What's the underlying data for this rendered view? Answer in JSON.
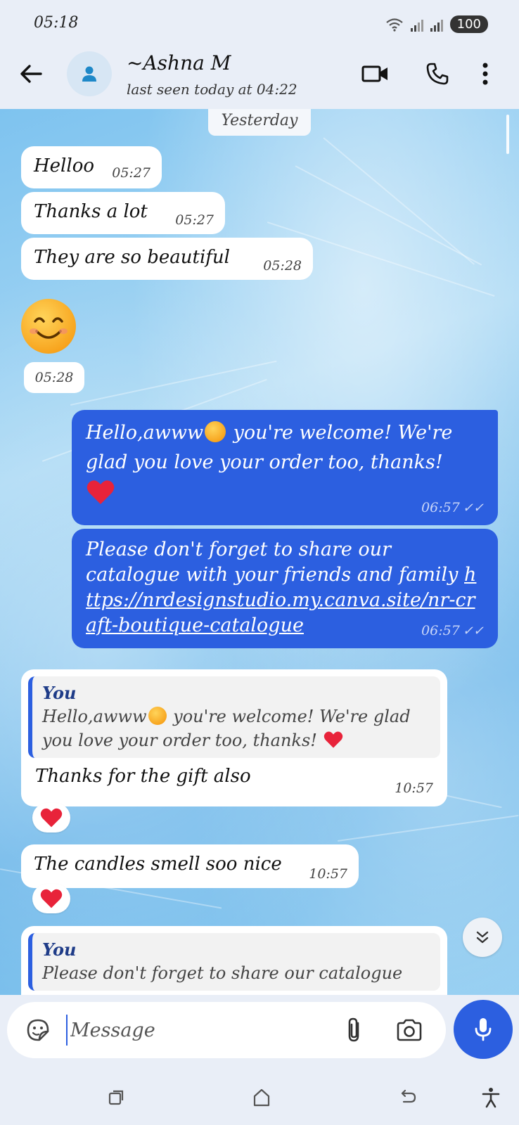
{
  "status_bar": {
    "time": "05:18",
    "battery": "100"
  },
  "header": {
    "contact_name": "~Ashna M",
    "contact_status": "last seen today at 04:22"
  },
  "chat": {
    "date_separator": "Yesterday",
    "messages": [
      {
        "direction": "in",
        "text": "Helloo",
        "time": "05:27"
      },
      {
        "direction": "in",
        "text": "Thanks a lot",
        "time": "05:27"
      },
      {
        "direction": "in",
        "text": "They are so beautiful",
        "time": "05:28"
      },
      {
        "direction": "in",
        "emoji": "smiling-face",
        "time": "05:28"
      },
      {
        "direction": "out",
        "text_part1": "Hello,awww",
        "text_part2": " you're welcome! We're glad you love your order too, thanks!",
        "time": "06:57",
        "ticks": "✓✓"
      },
      {
        "direction": "out",
        "text": "Please don't forget to share our catalogue with your friends and family",
        "link": "https://nrdesignstudio.my.canva.site/nr-craft-boutique-catalogue",
        "time": "06:57",
        "ticks": "✓✓"
      },
      {
        "direction": "in",
        "quote_author": "You",
        "quote_part1": "Hello,awww",
        "quote_part2": " you're welcome! We're glad you love your order too, thanks! ",
        "text": "Thanks for the gift also",
        "time": "10:57",
        "reaction": "heart"
      },
      {
        "direction": "in",
        "text": "The candles smell soo nice",
        "time": "10:57",
        "reaction": "heart"
      },
      {
        "direction": "in",
        "quote_author": "You",
        "quote_text": "Please don't forget to share our catalogue"
      }
    ]
  },
  "composer": {
    "placeholder": "Message"
  },
  "colors": {
    "accent": "#2c5fe0",
    "incoming_bubble": "#ffffff",
    "outgoing_bubble": "#2c5fe0",
    "heart": "#e8233a"
  }
}
